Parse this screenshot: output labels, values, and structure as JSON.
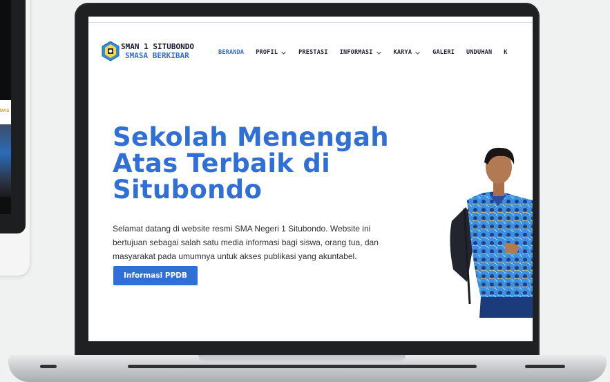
{
  "tablet": {
    "partial_text": "MAS"
  },
  "site": {
    "logo": {
      "title": "SMAN 1 SITUBONDO",
      "subtitle": "SMASA BERKIBAR"
    },
    "nav": [
      {
        "label": "BERANDA",
        "active": true,
        "dropdown": false
      },
      {
        "label": "PROFIL",
        "active": false,
        "dropdown": true
      },
      {
        "label": "PRESTASI",
        "active": false,
        "dropdown": false
      },
      {
        "label": "INFORMASI",
        "active": false,
        "dropdown": true
      },
      {
        "label": "KARYA",
        "active": false,
        "dropdown": true
      },
      {
        "label": "GALERI",
        "active": false,
        "dropdown": false
      },
      {
        "label": "UNDUHAN",
        "active": false,
        "dropdown": false
      },
      {
        "label": "K",
        "active": false,
        "dropdown": false
      }
    ]
  },
  "hero": {
    "title_line1": "Sekolah Menengah",
    "title_line2": "Atas Terbaik di",
    "title_line3": "Situbondo",
    "desc_line1": "Selamat datang di website resmi SMA Negeri 1 Situbondo. Website ini",
    "desc_line2": "bertujuan sebagai salah satu media informasi bagi siswa, orang tua, dan",
    "desc_line3": "masyarakat pada umumnya untuk akses publikasi yang akuntabel.",
    "cta_label": "Informasi PPDB"
  },
  "colors": {
    "brand_blue": "#2f6fd6",
    "nav_text": "#22243a",
    "laptop_bezel": "#1f2022",
    "page_bg": "#f0f2f1"
  },
  "icons": [
    "school-logo-icon",
    "chevron-down-icon"
  ]
}
